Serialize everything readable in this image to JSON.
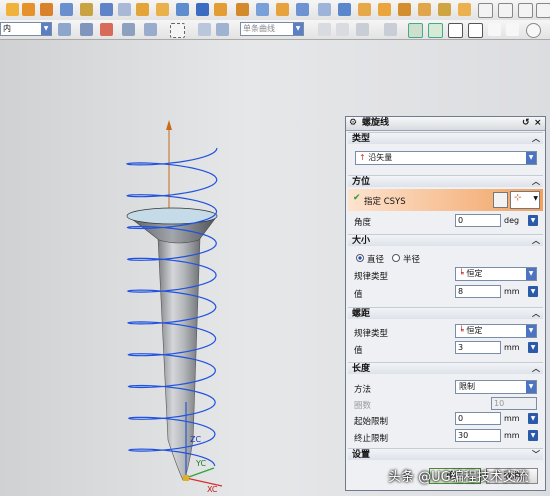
{
  "toolbar": {
    "filter_value": "内",
    "snap_filter_value": "单条曲线"
  },
  "viewport": {
    "axis_labels": {
      "zc": "ZC",
      "yc": "YC",
      "xc": "XC"
    }
  },
  "dialog": {
    "title": "螺旋线",
    "type": {
      "header": "类型",
      "value": "沿矢量"
    },
    "orientation": {
      "header": "方位",
      "csys_label": "指定 CSYS",
      "angle_label": "角度",
      "angle_value": "0",
      "angle_unit": "deg"
    },
    "size": {
      "header": "大小",
      "radio_diameter": "直径",
      "radio_radius": "半径",
      "law_type_label": "规律类型",
      "law_type_value": "恒定",
      "value_label": "值",
      "value": "8",
      "unit": "mm"
    },
    "pitch": {
      "header": "螺距",
      "law_type_label": "规律类型",
      "law_type_value": "恒定",
      "value_label": "值",
      "value": "3",
      "unit": "mm"
    },
    "length": {
      "header": "长度",
      "method_label": "方法",
      "method_value": "限制",
      "turns_label": "圈数",
      "turns_value": "10",
      "start_label": "起始限制",
      "start_value": "0",
      "start_unit": "mm",
      "end_label": "终止限制",
      "end_value": "30",
      "end_unit": "mm"
    },
    "settings": {
      "header": "设置"
    },
    "ok_label": "确定",
    "cancel_label": "取消"
  },
  "watermark": "头条 @UG编程技术交流",
  "colors": {
    "helix": "#1f52e0",
    "accent_orange": "#f1a160",
    "title_bar": "#dce0e6"
  }
}
